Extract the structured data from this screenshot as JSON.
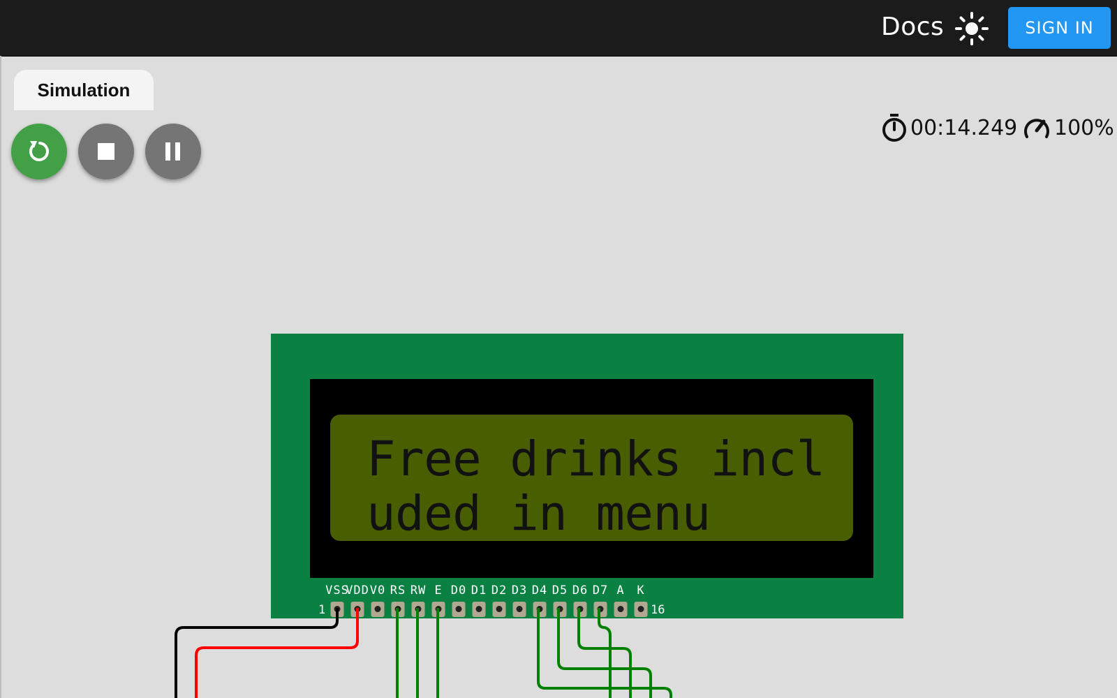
{
  "header": {
    "docs_label": "Docs",
    "sign_in_label": "SIGN IN",
    "theme_icon": "sun-icon",
    "accent_color": "#2196f3"
  },
  "simulation": {
    "tab_label": "Simulation",
    "controls": {
      "restart_icon": "restart-icon",
      "stop_icon": "stop-icon",
      "pause_icon": "pause-icon",
      "restart_color": "#43a047",
      "control_color": "#757575"
    },
    "elapsed_time": "00:14.249",
    "speed": "100%"
  },
  "lcd": {
    "line1": "Free drinks incl",
    "line2": "uded in menu",
    "pins": [
      "VSS",
      "VDD",
      "V0",
      "RS",
      "RW",
      "E",
      "D0",
      "D1",
      "D2",
      "D3",
      "D4",
      "D5",
      "D6",
      "D7",
      "A",
      "K"
    ],
    "first_pin_number": "1",
    "last_pin_number": "16",
    "board_color": "#0a8043",
    "screen_color": "#485e00"
  }
}
